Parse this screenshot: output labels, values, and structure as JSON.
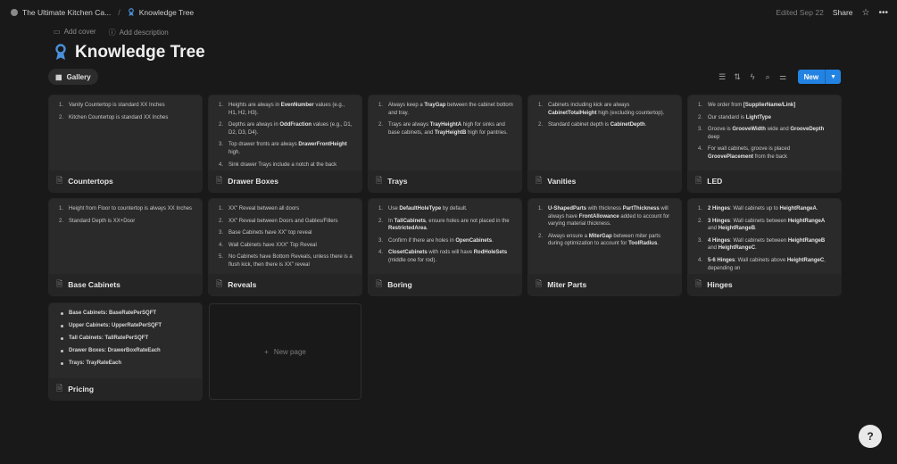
{
  "breadcrumb": {
    "workspace": "The Ultimate Kitchen Ca...",
    "page": "Knowledge Tree"
  },
  "topbar": {
    "edited": "Edited Sep 22",
    "share": "Share"
  },
  "header": {
    "add_cover": "Add cover",
    "add_description": "Add description",
    "title": "Knowledge Tree"
  },
  "view": {
    "gallery_label": "Gallery",
    "new_label": "New"
  },
  "cards": [
    {
      "title": "Countertops",
      "items": [
        "Vanity Countertop is standard XX Inches",
        "Kitchen Countertop is standard XX Inches"
      ]
    },
    {
      "title": "Drawer Boxes",
      "items": [
        "Heights are always in **EvenNumber** values (e.g., H1, H2, H3).",
        "Depths are always in **OddFraction** values (e.g., D1, D2, D3, D4).",
        "Top drawer fronts are always **DrawerFrontHeight** high.",
        "Sink drawer Trays include a notch at the back"
      ]
    },
    {
      "title": "Trays",
      "items": [
        "Always keep a **TrayGap** between the cabinet bottom and tray.",
        "Trays are always **TrayHeightA** high for sinks and base cabinets, and **TrayHeightB** high for pantries."
      ]
    },
    {
      "title": "Vanities",
      "items": [
        "Cabinets including kick are always **CabinetTotalHeight** high (excluding countertop).",
        "Standard cabinet depth is **CabinetDepth**."
      ]
    },
    {
      "title": "LED",
      "items": [
        "We order from **[SupplierName/Link]**",
        "Our standard is **LightType**",
        "Groove is **GrooveWidth** wide and **GrooveDepth** deep",
        "For wall cabinets, groove is placed **GroovePlacement** from the back"
      ]
    },
    {
      "title": "Base Cabinets",
      "items": [
        "Height from Floor to countertop is always XX Inches",
        "Standard Depth is XX+Door"
      ]
    },
    {
      "title": "Reveals",
      "items": [
        "XX\" Reveal between all doors",
        "XX\" Reveal between Doors and Gables/Fillers",
        "Base Cabinets have XX\" top reveal",
        "Wall Cabinets have XXX\" Top Reveal",
        "No Cabinets have Bottom Reveals, unless there is a flush kick, then there is XX\" reveal"
      ]
    },
    {
      "title": "Boring",
      "items": [
        "Use **DefaultHoleType** by default.",
        "In **TallCabinets**, ensure holes are not placed in the **RestrictedArea**.",
        "Confirm if there are holes in **OpenCabinets**.",
        "**ClosetCabinets** with rods will have **RodHoleSets** (middle one for rod)."
      ]
    },
    {
      "title": "Miter Parts",
      "items": [
        "**U-ShapedParts** with thickness **PartThickness** will always have **FrontAllowance** added to account for varying material thickness.",
        "Always ensure a **MiterGap** between miter parts during optimization to account for **ToolRadius**."
      ]
    },
    {
      "title": "Hinges",
      "items": [
        "**2 Hinges**: Wall cabinets up to **HeightRangeA**.",
        "**3 Hinges**: Wall cabinets between **HeightRangeA** and **HeightRangeB**.",
        "**4 Hinges**: Wall cabinets between **HeightRangeB** and **HeightRangeC**.",
        "**5-6 Hinges**: Wall cabinets above **HeightRangeC**, depending on"
      ]
    },
    {
      "title": "Pricing",
      "bullets": [
        "Base Cabinets: BaseRatePerSQFT",
        "Upper Cabinets: UpperRatePerSQFT",
        "Tall Cabinets: TallRatePerSQFT",
        "Drawer Boxes: DrawerBoxRateEach",
        "Trays: TrayRateEach"
      ]
    }
  ],
  "new_page": "New page",
  "icons": {
    "page": "page-icon",
    "title": "ribbon-icon",
    "help": "help-icon"
  },
  "colors": {
    "accent": "#2383e2",
    "background": "#191919",
    "card_preview": "#2a2a2a"
  }
}
